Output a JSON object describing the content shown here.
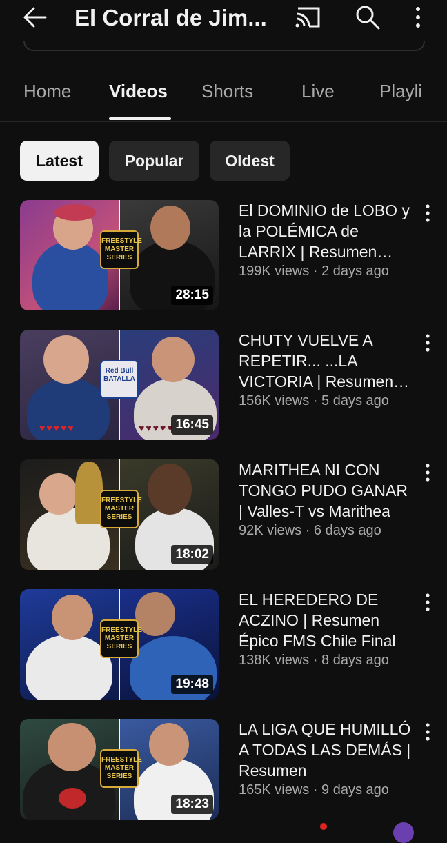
{
  "header": {
    "title": "El Corral de Jim...",
    "back_icon": "arrow-left-icon",
    "cast_icon": "cast-icon",
    "search_icon": "search-icon",
    "more_icon": "more-vert-icon"
  },
  "tabs": [
    {
      "label": "Home"
    },
    {
      "label": "Videos",
      "active": true
    },
    {
      "label": "Shorts"
    },
    {
      "label": "Live"
    },
    {
      "label": "Playli"
    }
  ],
  "filters": [
    {
      "label": "Latest",
      "active": true
    },
    {
      "label": "Popular"
    },
    {
      "label": "Oldest"
    }
  ],
  "videos": [
    {
      "title": "El DOMINIO de LOBO y la POLÉMICA de LARRIX | Resumen Épico",
      "views": "199K views",
      "age": "2 days ago",
      "info": "199K views · 2 days ago",
      "duration": "28:15"
    },
    {
      "title": "CHUTY VUELVE A REPETIR... ...LA VICTORIA | Resumen Épico",
      "views": "156K views",
      "age": "5 days ago",
      "info": "156K views · 5 days ago",
      "duration": "16:45"
    },
    {
      "title": "MARITHEA NI CON TONGO PUDO GANAR | Valles-T vs Marithea",
      "views": "92K views",
      "age": "6 days ago",
      "info": "92K views · 6 days ago",
      "duration": "18:02"
    },
    {
      "title": "EL HEREDERO DE ACZINO | Resumen Épico FMS Chile Final",
      "views": "138K views",
      "age": "8 days ago",
      "info": "138K views · 8 days ago",
      "duration": "19:48"
    },
    {
      "title": "LA LIGA QUE HUMILLÓ A TODAS LAS DEMÁS | Resumen",
      "views": "165K views",
      "age": "9 days ago",
      "info": "165K views · 9 days ago",
      "duration": "18:23"
    }
  ],
  "thumbnail_text": {
    "fms_logo": "FREESTYLE MASTER SERIES",
    "redbull_logo": "Red Bull BATALLA"
  },
  "colors": {
    "background": "#0f0f0f",
    "text_primary": "#f1f1f1",
    "text_secondary": "#aaaaaa",
    "chip_bg": "#272727",
    "chip_active_bg": "#f1f1f1"
  }
}
